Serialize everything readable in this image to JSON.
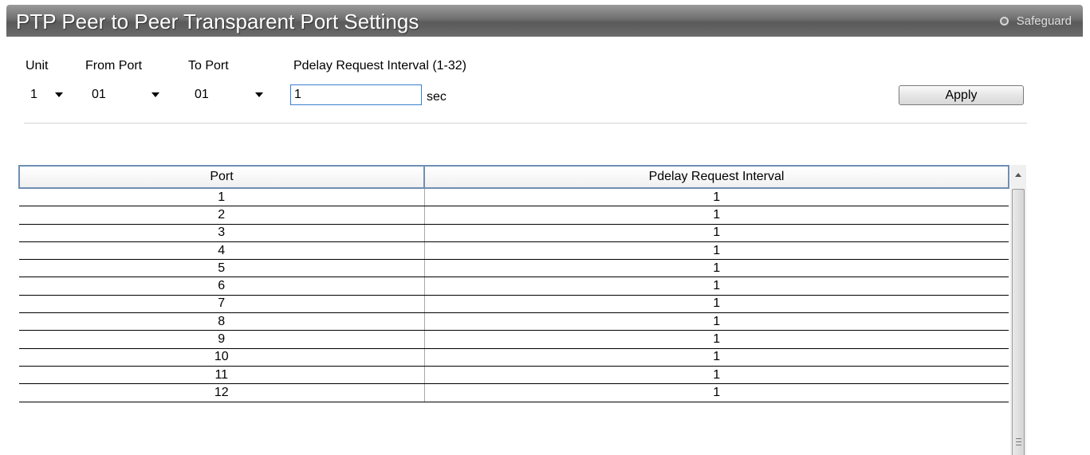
{
  "header": {
    "title": "PTP Peer to Peer Transparent Port Settings",
    "safeguard_label": "Safeguard"
  },
  "form": {
    "unit_label": "Unit",
    "unit_value": "1",
    "from_port_label": "From Port",
    "from_port_value": "01",
    "to_port_label": "To Port",
    "to_port_value": "01",
    "interval_label": "Pdelay Request Interval (1-32)",
    "interval_value": "1",
    "interval_unit": "sec",
    "apply_label": "Apply"
  },
  "table": {
    "columns": [
      "Port",
      "Pdelay Request Interval"
    ],
    "rows": [
      [
        "1",
        "1"
      ],
      [
        "2",
        "1"
      ],
      [
        "3",
        "1"
      ],
      [
        "4",
        "1"
      ],
      [
        "5",
        "1"
      ],
      [
        "6",
        "1"
      ],
      [
        "7",
        "1"
      ],
      [
        "8",
        "1"
      ],
      [
        "9",
        "1"
      ],
      [
        "10",
        "1"
      ],
      [
        "11",
        "1"
      ],
      [
        "12",
        "1"
      ]
    ]
  },
  "colors": {
    "title_bar": "#6f6f6f",
    "header_border": "#6f8fb3",
    "input_focus_border": "#3a7fd0"
  },
  "icons": {
    "safeguard": "status-led-icon",
    "dropdown": "chevron-down-icon",
    "scroll_up": "scroll-up-arrow-icon"
  }
}
